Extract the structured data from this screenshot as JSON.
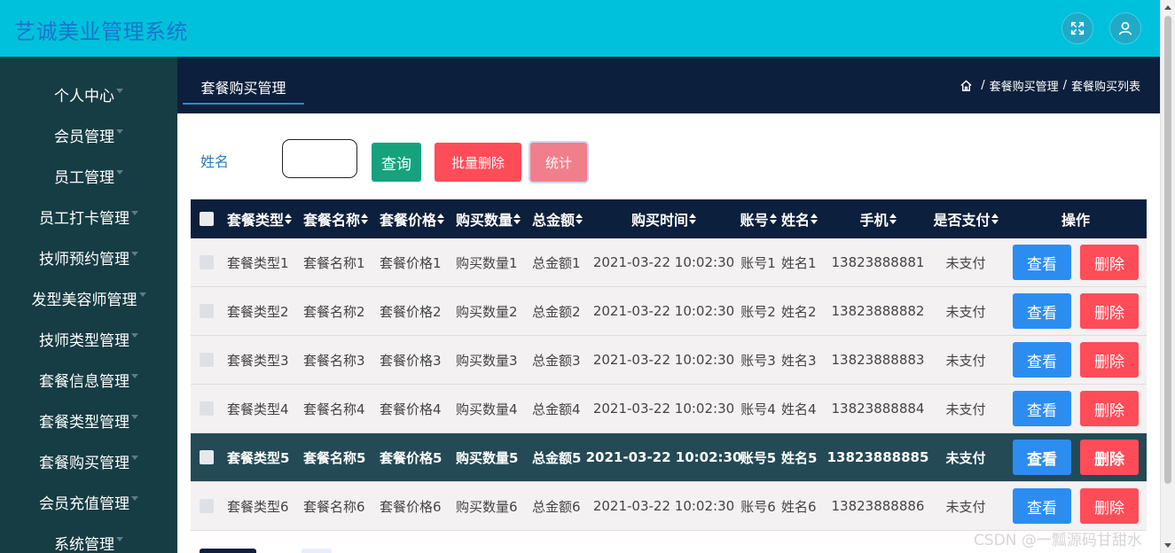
{
  "header": {
    "title": "艺诚美业管理系统"
  },
  "sidebar": {
    "items": [
      {
        "label": "个人中心"
      },
      {
        "label": "会员管理"
      },
      {
        "label": "员工管理"
      },
      {
        "label": "员工打卡管理"
      },
      {
        "label": "技师预约管理"
      },
      {
        "label": "发型美容师管理"
      },
      {
        "label": "技师类型管理"
      },
      {
        "label": "套餐信息管理"
      },
      {
        "label": "套餐类型管理"
      },
      {
        "label": "套餐购买管理"
      },
      {
        "label": "会员充值管理"
      },
      {
        "label": "系统管理"
      }
    ]
  },
  "subheader": {
    "title": "套餐购买管理",
    "breadcrumb": [
      "套餐购买管理",
      "套餐购买列表"
    ],
    "separator": "/"
  },
  "search": {
    "label": "姓名",
    "value": "",
    "query_label": "查询",
    "batch_delete_label": "批量删除",
    "stats_label": "统计"
  },
  "table": {
    "headers": [
      "套餐类型",
      "套餐名称",
      "套餐价格",
      "购买数量",
      "总金额",
      "购买时间",
      "账号",
      "姓名",
      "手机",
      "是否支付",
      "操作"
    ],
    "view_label": "查看",
    "delete_label": "删除",
    "rows": [
      [
        "套餐类型1",
        "套餐名称1",
        "套餐价格1",
        "购买数量1",
        "总金额1",
        "2021-03-22 10:02:30",
        "账号1",
        "姓名1",
        "13823888881",
        "未支付"
      ],
      [
        "套餐类型2",
        "套餐名称2",
        "套餐价格2",
        "购买数量2",
        "总金额2",
        "2021-03-22 10:02:30",
        "账号2",
        "姓名2",
        "13823888882",
        "未支付"
      ],
      [
        "套餐类型3",
        "套餐名称3",
        "套餐价格3",
        "购买数量3",
        "总金额3",
        "2021-03-22 10:02:30",
        "账号3",
        "姓名3",
        "13823888883",
        "未支付"
      ],
      [
        "套餐类型4",
        "套餐名称4",
        "套餐价格4",
        "购买数量4",
        "总金额4",
        "2021-03-22 10:02:30",
        "账号4",
        "姓名4",
        "13823888884",
        "未支付"
      ],
      [
        "套餐类型5",
        "套餐名称5",
        "套餐价格5",
        "购买数量5",
        "总金额5",
        "2021-03-22 10:02:30",
        "账号5",
        "姓名5",
        "13823888885",
        "未支付"
      ],
      [
        "套餐类型6",
        "套餐名称6",
        "套餐价格6",
        "购买数量6",
        "总金额6",
        "2021-03-22 10:02:30",
        "账号6",
        "姓名6",
        "13823888886",
        "未支付"
      ]
    ]
  },
  "watermark": "CSDN @一瓢源码甘甜水",
  "colors": {
    "topbar": "#00c1dc",
    "sidebar": "#163c44",
    "navy": "#0c1f3c",
    "primary": "#2c8df0",
    "danger": "#ff4c59",
    "success": "#15a27d"
  }
}
